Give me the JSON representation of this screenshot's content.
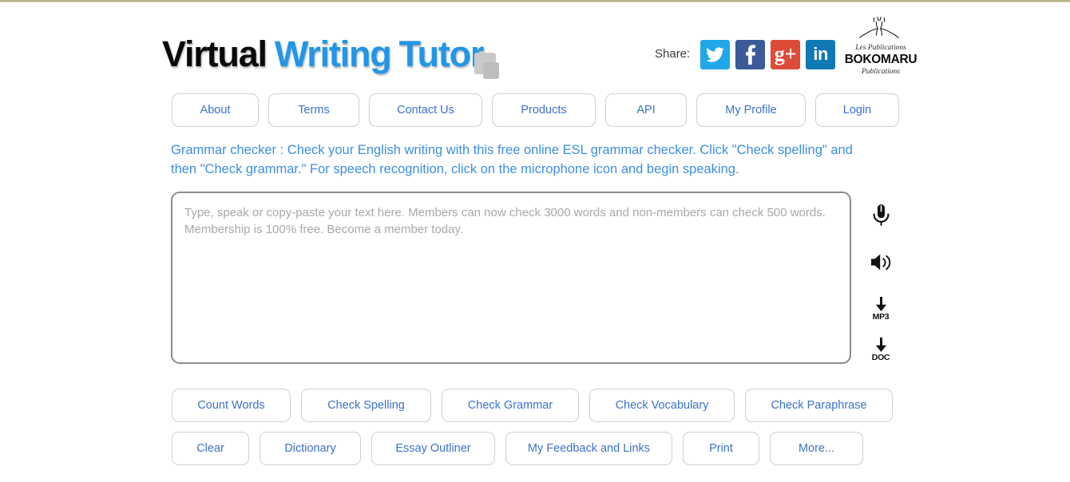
{
  "header": {
    "logo": {
      "word_1": "Virtual",
      "word_2": "Writing",
      "word_3": "Tutor"
    },
    "share_label": "Share:",
    "share_icons": [
      {
        "name": "twitter-icon",
        "label": "Twitter",
        "color": "#20a7e8"
      },
      {
        "name": "facebook-icon",
        "label": "Facebook",
        "color": "#3a5a98"
      },
      {
        "name": "google-plus-icon",
        "label": "g+",
        "color": "#dd4b39"
      },
      {
        "name": "linkedin-icon",
        "label": "in",
        "color": "#1079b5"
      }
    ],
    "publisher_logo": {
      "line_1": "Les Publications",
      "line_2": "BOKOMARU",
      "line_3": "Publications"
    }
  },
  "nav": {
    "items": [
      {
        "label": "About"
      },
      {
        "label": "Terms"
      },
      {
        "label": "Contact Us"
      },
      {
        "label": "Products"
      },
      {
        "label": "API"
      },
      {
        "label": "My Profile"
      },
      {
        "label": "Login"
      }
    ]
  },
  "intro": {
    "text": "Grammar checker : Check your English writing with this free online ESL grammar checker. Click \"Check spelling\" and then \"Check grammar.\" For speech recognition, click on the microphone icon and begin speaking."
  },
  "editor": {
    "placeholder": "Type, speak or copy-paste your text here. Members can now check 3000 words and non-members can check 500 words. Membership is 100% free. Become a member today.",
    "value": ""
  },
  "tools": [
    {
      "name": "microphone-icon",
      "caption": ""
    },
    {
      "name": "speaker-icon",
      "caption": ""
    },
    {
      "name": "download-mp3-icon",
      "caption": "MP3"
    },
    {
      "name": "download-doc-icon",
      "caption": "DOC"
    }
  ],
  "actions": {
    "row_1": [
      {
        "label": "Count Words"
      },
      {
        "label": "Check Spelling"
      },
      {
        "label": "Check Grammar"
      },
      {
        "label": "Check Vocabulary"
      },
      {
        "label": "Check Paraphrase"
      }
    ],
    "row_2": [
      {
        "label": "Clear"
      },
      {
        "label": "Dictionary"
      },
      {
        "label": "Essay Outliner"
      },
      {
        "label": "My Feedback and Links"
      },
      {
        "label": "Print"
      },
      {
        "label": "More..."
      }
    ]
  },
  "colors": {
    "accent_blue": "#3b72c9",
    "intro_blue": "#3b8fe0",
    "logo_blue": "#2196e8",
    "top_rule": "#b5b389"
  }
}
